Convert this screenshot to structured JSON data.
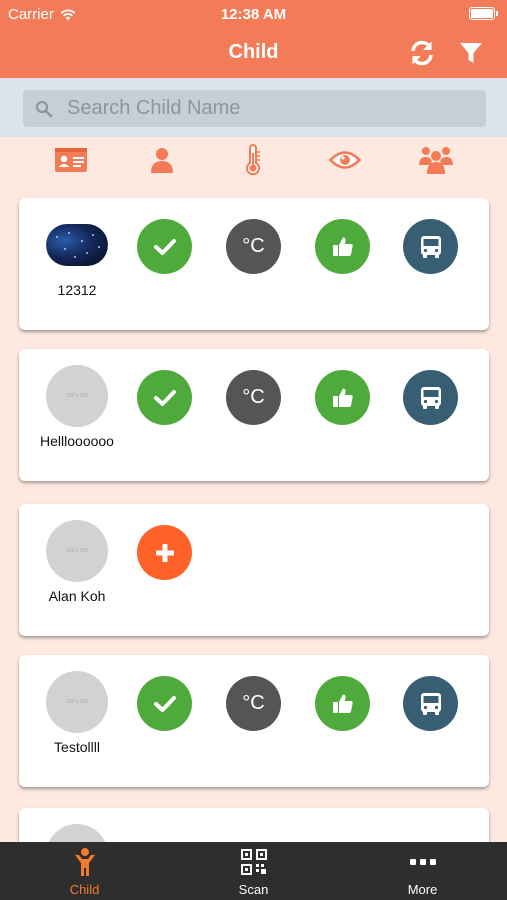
{
  "status_bar": {
    "carrier": "Carrier",
    "time": "12:38 AM"
  },
  "header": {
    "title": "Child",
    "refresh_icon": "refresh-icon",
    "filter_icon": "filter-icon"
  },
  "search": {
    "placeholder": "Search Child Name",
    "value": ""
  },
  "filters": [
    {
      "icon": "id-card-icon"
    },
    {
      "icon": "user-icon"
    },
    {
      "icon": "thermometer-icon"
    },
    {
      "icon": "eye-icon"
    },
    {
      "icon": "group-icon"
    }
  ],
  "children": [
    {
      "name": "12312",
      "has_photo": true,
      "actions": [
        "check",
        "temperature",
        "thumbs-up",
        "bus"
      ]
    },
    {
      "name": "Hellloooooo",
      "avatar_placeholder": "150 x 150",
      "actions": [
        "check",
        "temperature",
        "thumbs-up",
        "bus"
      ]
    },
    {
      "name": "Alan Koh",
      "avatar_placeholder": "150 x 150",
      "actions": [
        "add"
      ]
    },
    {
      "name": "Testollll",
      "avatar_placeholder": "150 x 150",
      "actions": [
        "check",
        "temperature",
        "thumbs-up",
        "bus"
      ]
    }
  ],
  "temperature_label": "°C",
  "tabs": [
    {
      "label": "Child",
      "icon": "child-icon",
      "active": true
    },
    {
      "label": "Scan",
      "icon": "qr-code-icon",
      "active": false
    },
    {
      "label": "More",
      "icon": "more-icon",
      "active": false
    }
  ],
  "colors": {
    "header": "#f37b57",
    "page_bg": "#fde9e0",
    "check_green": "#4faa3c",
    "temperature_gray": "#555555",
    "bus_blue": "#385e74",
    "add_orange": "#ff6228",
    "tab_active": "#f37b2c",
    "tabbar_bg": "#2e2e2e"
  }
}
